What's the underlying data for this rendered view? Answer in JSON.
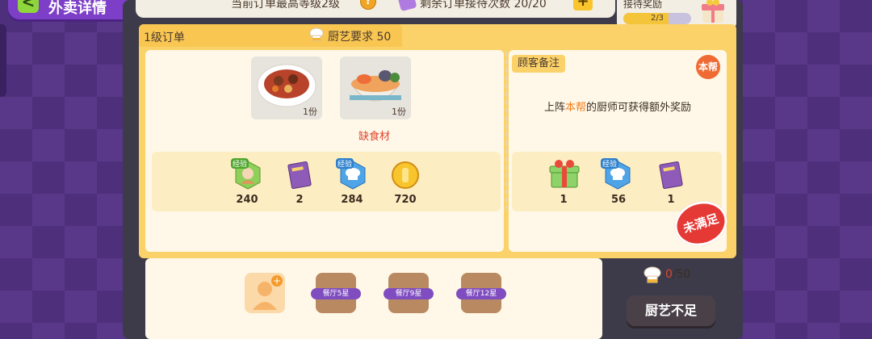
{
  "header": {
    "back_label": "<",
    "title": "外卖详情"
  },
  "topbar": {
    "max_level_text": "当前订单最高等级2级",
    "help_icon_label": "?",
    "remaining_text": "剩余订单接待次数 20/20",
    "plus_label": "+"
  },
  "reception_reward": {
    "label": "接待奖励",
    "progress_text": "2/3",
    "progress": 0.667
  },
  "order": {
    "level_label": "1级订单",
    "chef_requirement": "厨艺要求 50",
    "dishes": [
      {
        "icon": "curry-dish-icon",
        "qty": "1份"
      },
      {
        "icon": "seafood-noodle-icon",
        "qty": "1份"
      }
    ],
    "missing_text": "缺食材",
    "rewards_left": [
      {
        "icon": "exp-chef-icon",
        "badge": "经验",
        "value": "240"
      },
      {
        "icon": "recipe-book-icon",
        "value": "2"
      },
      {
        "icon": "exp-toque-icon",
        "badge": "经验",
        "value": "284"
      },
      {
        "icon": "gold-coin-icon",
        "value": "720"
      }
    ],
    "note_label": "顾客备注",
    "note_badge": "本帮",
    "note_text_prefix": "上阵",
    "note_text_highlight": "本帮",
    "note_text_suffix": "的厨师可获得额外奖励",
    "rewards_right": [
      {
        "icon": "gift-box-icon",
        "value": "1"
      },
      {
        "icon": "exp-toque-icon",
        "badge": "经验",
        "value": "56"
      },
      {
        "icon": "recipe-book-icon",
        "value": "1"
      }
    ],
    "unmet_stamp": "未满足"
  },
  "slots": [
    {
      "type": "add",
      "label": ""
    },
    {
      "type": "locked",
      "label": "餐厅5星"
    },
    {
      "type": "locked",
      "label": "餐厅9星"
    },
    {
      "type": "locked",
      "label": "餐厅12星"
    }
  ],
  "chef_progress": {
    "current": "0",
    "total": "/50"
  },
  "action_button": "厨艺不足",
  "colors": {
    "accent_yellow": "#fbd26a",
    "panel_cream": "#fff8e8",
    "alert_red": "#e53935",
    "purple_bg": "#5b3a8c"
  }
}
